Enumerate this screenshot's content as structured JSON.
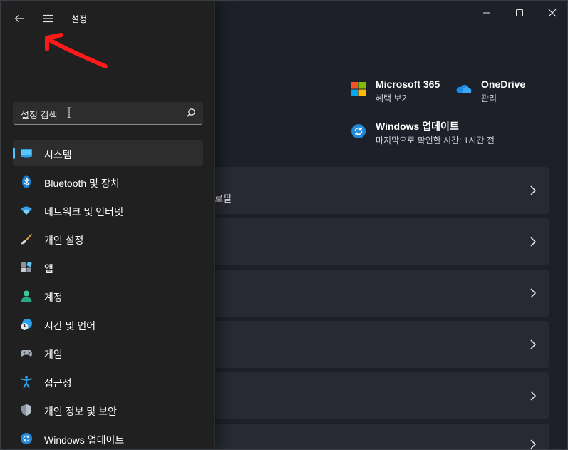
{
  "app": {
    "title": "설정"
  },
  "search": {
    "value": "설정 검색"
  },
  "nav": {
    "items": [
      {
        "label": "시스템",
        "icon": "monitor-icon",
        "active": true
      },
      {
        "label": "Bluetooth 및 장치",
        "icon": "bluetooth-icon"
      },
      {
        "label": "네트워크 및 인터넷",
        "icon": "wifi-icon"
      },
      {
        "label": "개인 설정",
        "icon": "paintbrush-icon"
      },
      {
        "label": "앱",
        "icon": "apps-icon"
      },
      {
        "label": "계정",
        "icon": "account-icon"
      },
      {
        "label": "시간 및 언어",
        "icon": "clock-globe-icon"
      },
      {
        "label": "게임",
        "icon": "gamepad-icon"
      },
      {
        "label": "접근성",
        "icon": "accessibility-icon"
      },
      {
        "label": "개인 정보 및 보안",
        "icon": "shield-icon"
      },
      {
        "label": "Windows 업데이트",
        "icon": "sync-icon"
      }
    ]
  },
  "quick": {
    "m365": {
      "title": "Microsoft 365",
      "sub": "혜택 보기"
    },
    "onedrive": {
      "title": "OneDrive",
      "sub": "관리"
    },
    "update": {
      "title": "Windows 업데이트",
      "sub": "마지막으로 확인한 시간: 1시간 전"
    }
  },
  "cards": {
    "first_fragment": "로필"
  },
  "colors": {
    "accent": "#4cc2ff",
    "annotation": "#ff1a1a"
  }
}
